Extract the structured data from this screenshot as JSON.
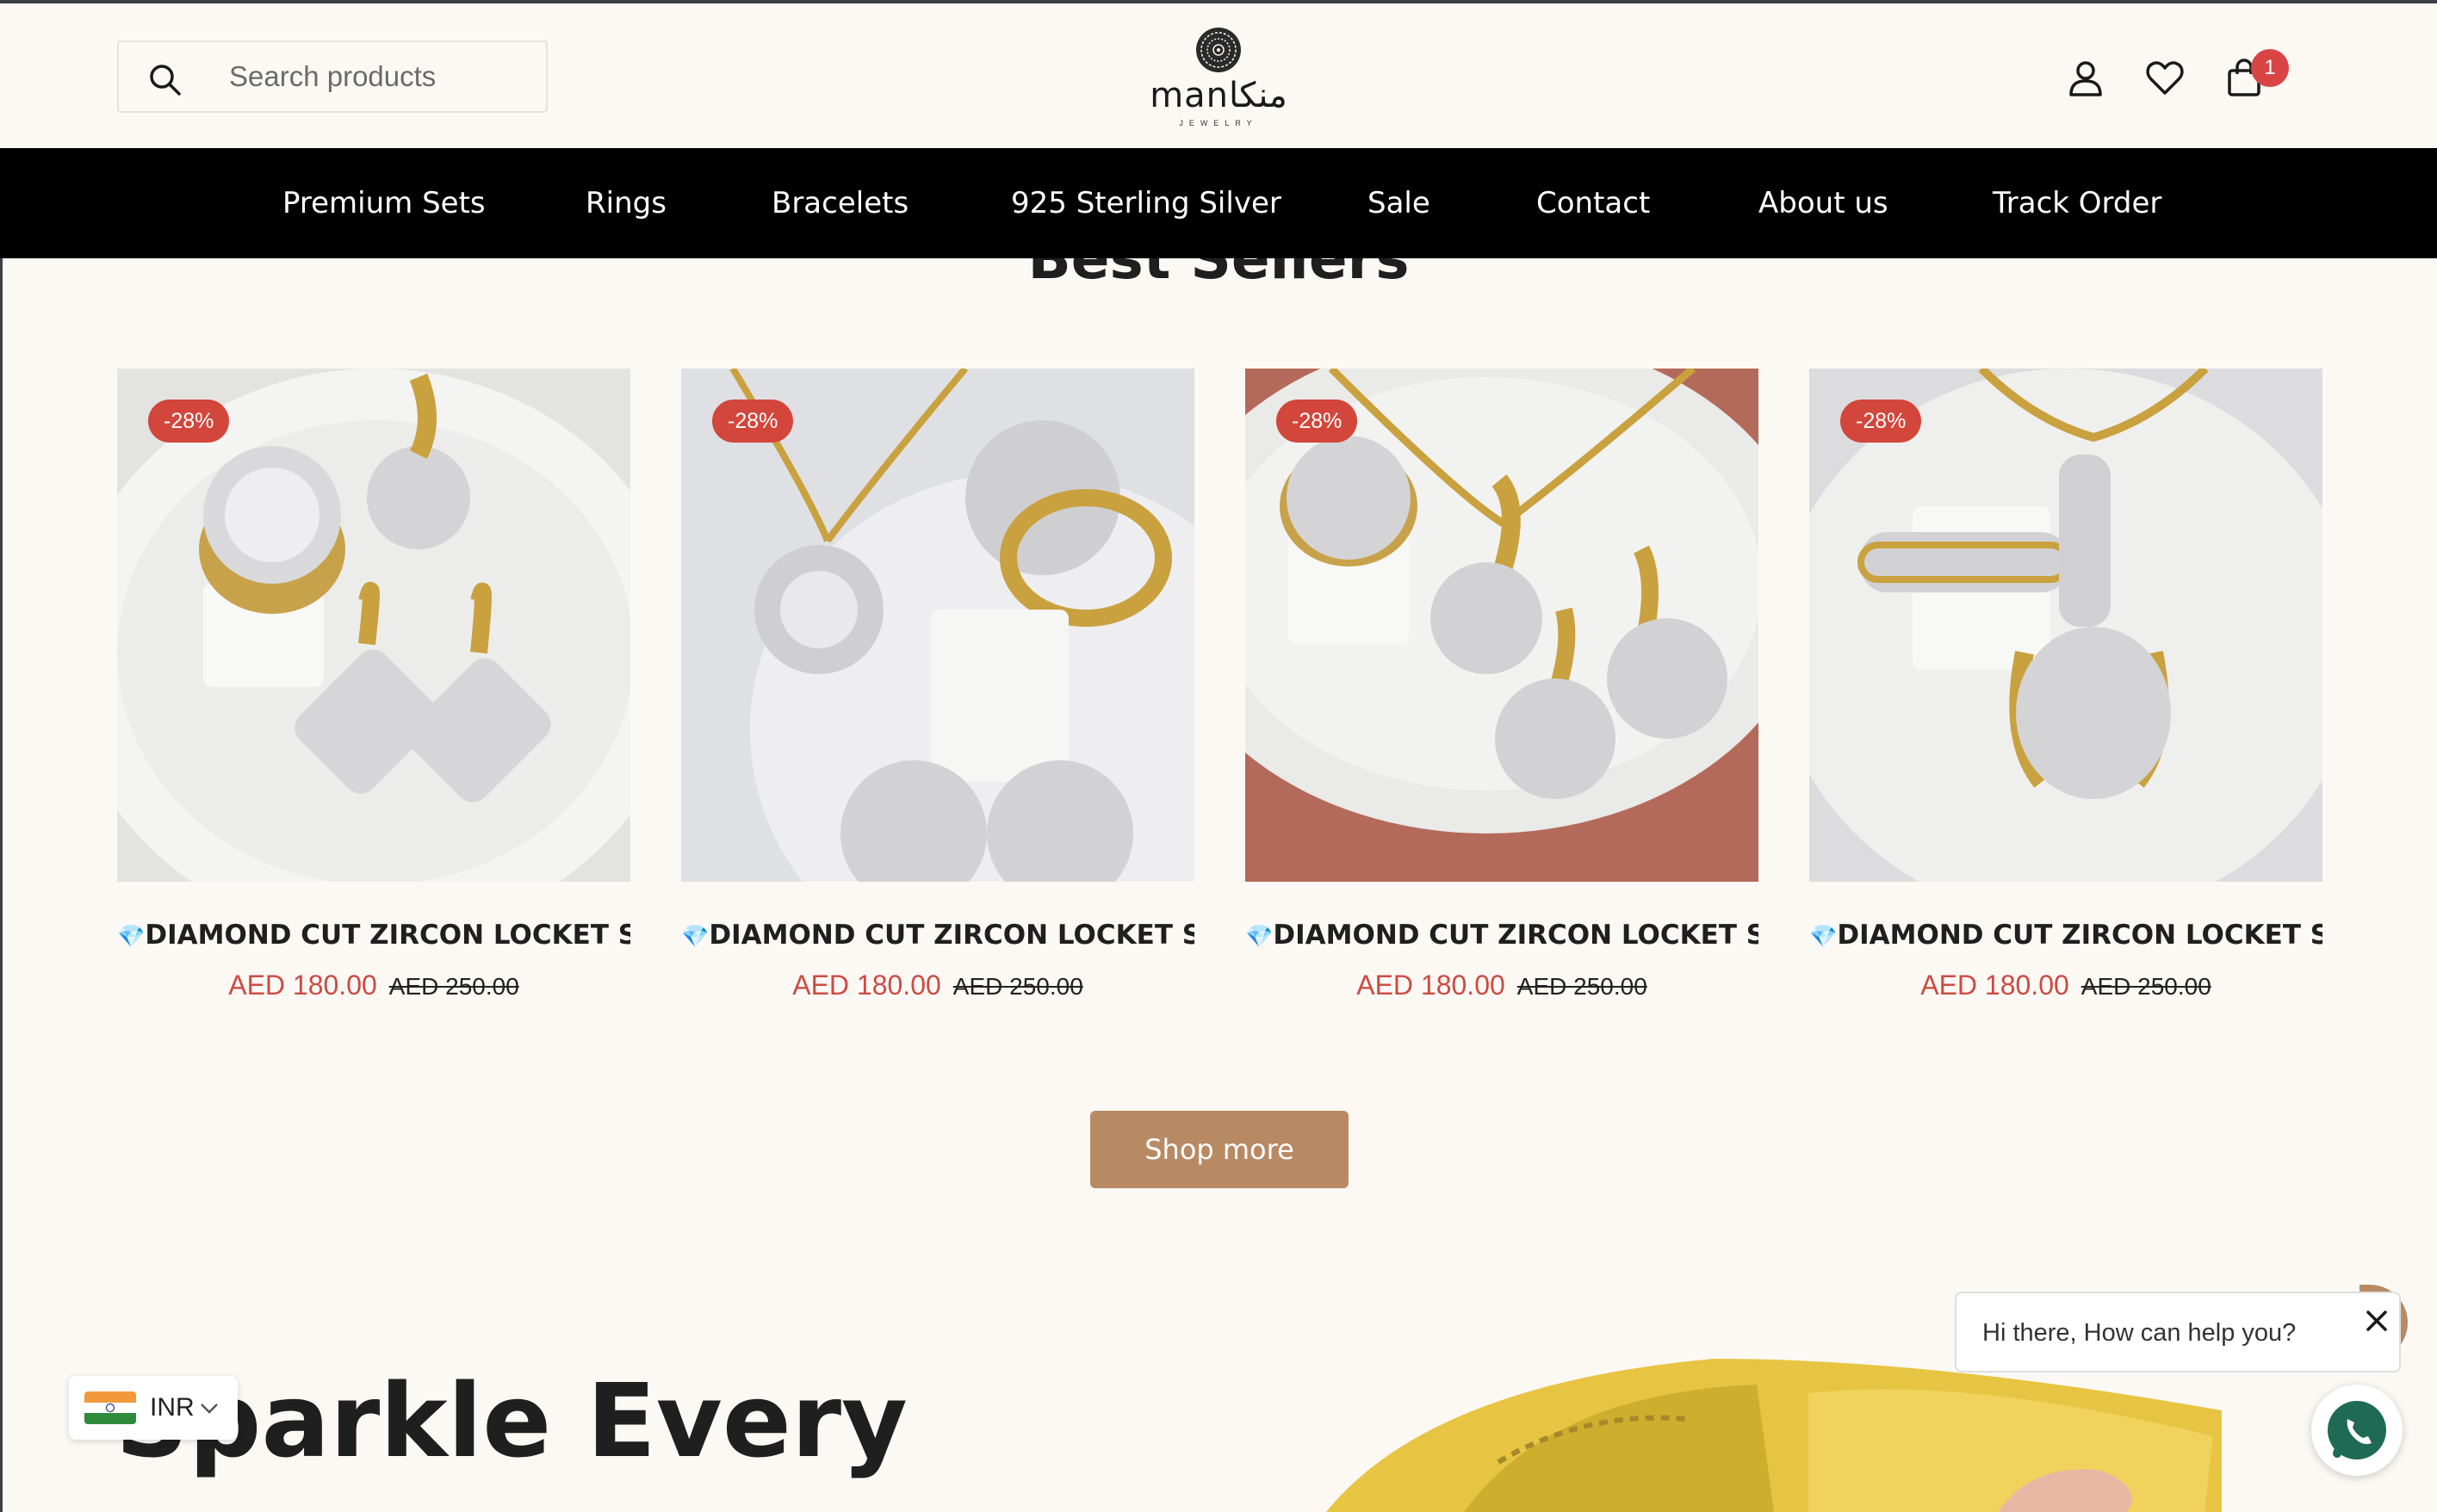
{
  "header": {
    "search_placeholder": "Search products",
    "logo_text": "manمنكا",
    "logo_sub": "JEWELRY",
    "cart_count": "1"
  },
  "nav": {
    "items": [
      "Premium Sets",
      "Rings",
      "Bracelets",
      "925 Sterling Silver",
      "Sale",
      "Contact",
      "About us",
      "Track Order"
    ]
  },
  "section_title": "Best Sellers",
  "products": [
    {
      "badge": "-28%",
      "title": "DIAMOND CUT ZIRCON LOCKET SE...",
      "price": "AED 180.00",
      "old_price": "AED 250.00",
      "icon": "diamond-icon"
    },
    {
      "badge": "-28%",
      "title": "DIAMOND CUT ZIRCON LOCKET SE...",
      "price": "AED 180.00",
      "old_price": "AED 250.00",
      "icon": "diamond-icon"
    },
    {
      "badge": "-28%",
      "title": "DIAMOND CUT ZIRCON LOCKET SE...",
      "price": "AED 180.00",
      "old_price": "AED 250.00",
      "icon": "diamond-icon"
    },
    {
      "badge": "-28%",
      "title": "DIAMOND CUT ZIRCON LOCKET SE...",
      "price": "AED 180.00",
      "old_price": "AED 250.00",
      "icon": "diamond-icon"
    }
  ],
  "shop_more_label": "Shop more",
  "hero_text": "Sparkle Every",
  "currency": {
    "code": "INR",
    "flag": "india-flag-icon"
  },
  "chat": {
    "message": "Hi there, How can help you?"
  },
  "colors": {
    "accent": "#b88a64",
    "sale": "#cc4b43",
    "badge": "#d2463c",
    "nav_bg": "#000000",
    "page_bg": "#fcf9f5"
  }
}
